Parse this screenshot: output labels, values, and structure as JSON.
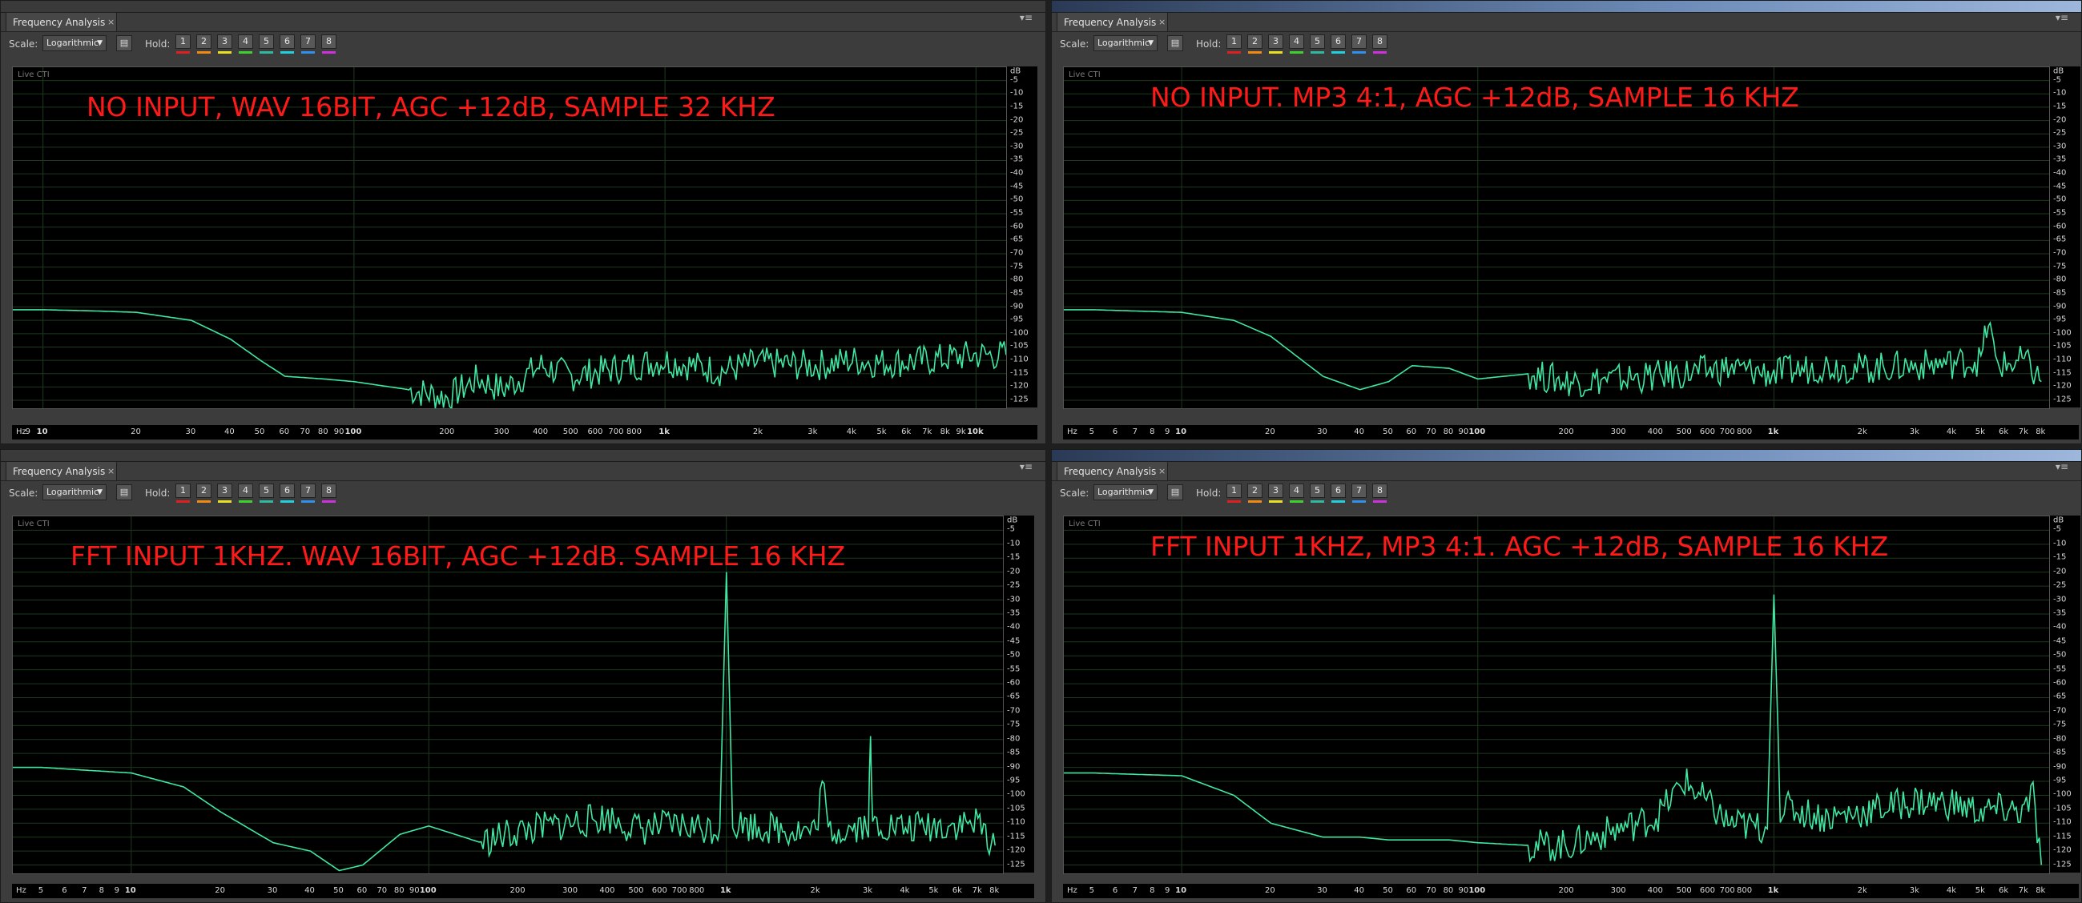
{
  "colors": {
    "trace": "#3fe8a2",
    "annotation": "#ff1a1a",
    "grid": "#1c3a1c"
  },
  "hold": {
    "label": "Hold:",
    "buttons": [
      "1",
      "2",
      "3",
      "4",
      "5",
      "6",
      "7",
      "8"
    ],
    "swatches": [
      "#e02020",
      "#f08a10",
      "#e8e020",
      "#40d030",
      "#30b8a0",
      "#20d0e0",
      "#3090f0",
      "#d030e0"
    ]
  },
  "panels": [
    {
      "tab_label": "Frequency Analysis",
      "scale_label": "Scale:",
      "scale_value": "Logarithmic",
      "live_label": "Live CTI",
      "annotation": "NO INPUT, WAV 16BIT, AGC +12dB, SAMPLE 32 KHZ",
      "hz_label": "Hz",
      "db_label": "dB",
      "x_ticks": [
        "9",
        "10",
        "20",
        "30",
        "40",
        "50",
        "60",
        "70",
        "80",
        "90",
        "100",
        "200",
        "300",
        "400",
        "500",
        "600",
        "700",
        "800",
        "1k",
        "2k",
        "3k",
        "4k",
        "5k",
        "6k",
        "7k",
        "8k",
        "9k",
        "10k"
      ]
    },
    {
      "tab_label": "Frequency Analysis",
      "scale_label": "Scale:",
      "scale_value": "Logarithmic",
      "live_label": "Live CTI",
      "annotation": "NO INPUT. MP3 4:1, AGC +12dB, SAMPLE 16 KHZ",
      "hz_label": "Hz",
      "db_label": "dB",
      "x_ticks": [
        "5",
        "6",
        "7",
        "8",
        "9",
        "10",
        "20",
        "30",
        "40",
        "50",
        "60",
        "70",
        "80",
        "90",
        "100",
        "200",
        "300",
        "400",
        "500",
        "600",
        "700",
        "800",
        "1k",
        "2k",
        "3k",
        "4k",
        "5k",
        "6k",
        "7k",
        "8k"
      ]
    },
    {
      "tab_label": "Frequency Analysis",
      "scale_label": "Scale:",
      "scale_value": "Logarithmic",
      "live_label": "Live CTI",
      "annotation": "FFT INPUT 1KHZ. WAV 16BIT, AGC +12dB. SAMPLE 16 KHZ",
      "hz_label": "Hz",
      "db_label": "dB",
      "x_ticks": [
        "5",
        "6",
        "7",
        "8",
        "9",
        "10",
        "20",
        "30",
        "40",
        "50",
        "60",
        "70",
        "80",
        "90",
        "100",
        "200",
        "300",
        "400",
        "500",
        "600",
        "700",
        "800",
        "1k",
        "2k",
        "3k",
        "4k",
        "5k",
        "6k",
        "7k",
        "8k"
      ]
    },
    {
      "tab_label": "Frequency Analysis",
      "scale_label": "Scale:",
      "scale_value": "Logarithmic",
      "live_label": "Live CTI",
      "annotation": "FFT INPUT 1KHZ, MP3 4:1. AGC +12dB, SAMPLE 16 KHZ",
      "hz_label": "Hz",
      "db_label": "dB",
      "x_ticks": [
        "5",
        "6",
        "7",
        "8",
        "9",
        "10",
        "20",
        "30",
        "40",
        "50",
        "60",
        "70",
        "80",
        "90",
        "100",
        "200",
        "300",
        "400",
        "500",
        "600",
        "700",
        "800",
        "1k",
        "2k",
        "3k",
        "4k",
        "5k",
        "6k",
        "7k",
        "8k"
      ]
    }
  ],
  "y_ticks": [
    "-5",
    "-10",
    "-15",
    "-20",
    "-25",
    "-30",
    "-35",
    "-40",
    "-45",
    "-50",
    "-55",
    "-60",
    "-65",
    "-70",
    "-75",
    "-80",
    "-85",
    "-90",
    "-95",
    "-100",
    "-105",
    "-110",
    "-115",
    "-120",
    "-125"
  ],
  "chart_data": [
    {
      "type": "line",
      "x_scale": "log",
      "xlim": [
        8,
        12500
      ],
      "ylim": [
        -128,
        0
      ],
      "x": [
        8,
        10,
        15,
        20,
        30,
        40,
        50,
        60,
        80,
        100,
        150,
        200,
        250,
        300,
        400,
        500,
        700,
        1000,
        1500,
        2000,
        3000,
        4000,
        5000,
        7000,
        10000,
        12500
      ],
      "y": [
        -91,
        -91,
        -91.5,
        -92,
        -95,
        -102,
        -110,
        -116,
        -117,
        -118,
        -121,
        -124,
        -117,
        -121,
        -112,
        -116,
        -113,
        -110,
        -114,
        -111,
        -112,
        -110,
        -111,
        -110,
        -108,
        -108
      ]
    },
    {
      "type": "line",
      "x_scale": "log",
      "xlim": [
        4,
        8500
      ],
      "ylim": [
        -128,
        0
      ],
      "x": [
        4,
        5,
        7,
        10,
        15,
        20,
        30,
        40,
        50,
        60,
        80,
        100,
        150,
        200,
        300,
        400,
        500,
        700,
        1000,
        1500,
        2000,
        3000,
        4000,
        5000,
        5300,
        5600,
        6000,
        7000,
        8000
      ],
      "y": [
        -91,
        -91,
        -91.5,
        -92,
        -95,
        -101,
        -116,
        -121,
        -118,
        -112,
        -113,
        -117,
        -115,
        -118,
        -117,
        -116,
        -115,
        -113,
        -115,
        -112,
        -113,
        -112,
        -111,
        -110,
        -95,
        -110,
        -112,
        -110,
        -118
      ]
    },
    {
      "type": "line",
      "x_scale": "log",
      "xlim": [
        4,
        8500
      ],
      "ylim": [
        -128,
        0
      ],
      "x": [
        4,
        5,
        7,
        10,
        15,
        20,
        30,
        40,
        50,
        60,
        80,
        100,
        150,
        200,
        300,
        400,
        500,
        700,
        950,
        1000,
        1050,
        1500,
        2000,
        2100,
        2200,
        2500,
        3000,
        3050,
        3100,
        4000,
        5000,
        7000,
        8000
      ],
      "y": [
        -90,
        -90,
        -91,
        -92,
        -97,
        -106,
        -117,
        -120,
        -127,
        -125,
        -114,
        -111,
        -117,
        -113,
        -110,
        -108,
        -112,
        -111,
        -112,
        -20,
        -110,
        -112,
        -113,
        -95,
        -113,
        -112,
        -110,
        -83,
        -110,
        -112,
        -111,
        -110,
        -118
      ]
    },
    {
      "type": "line",
      "x_scale": "log",
      "xlim": [
        4,
        8500
      ],
      "ylim": [
        -128,
        0
      ],
      "x": [
        4,
        5,
        7,
        10,
        15,
        20,
        30,
        40,
        50,
        60,
        80,
        100,
        150,
        200,
        300,
        400,
        500,
        700,
        950,
        1000,
        1050,
        1500,
        2000,
        3000,
        4000,
        5000,
        6000,
        7000,
        7500,
        8000
      ],
      "y": [
        -92,
        -92,
        -92.5,
        -93,
        -100,
        -110,
        -115,
        -115,
        -116,
        -116,
        -116,
        -117,
        -118,
        -118,
        -112,
        -108,
        -95,
        -110,
        -112,
        -28,
        -104,
        -108,
        -106,
        -102,
        -103,
        -106,
        -105,
        -106,
        -100,
        -125
      ]
    }
  ]
}
